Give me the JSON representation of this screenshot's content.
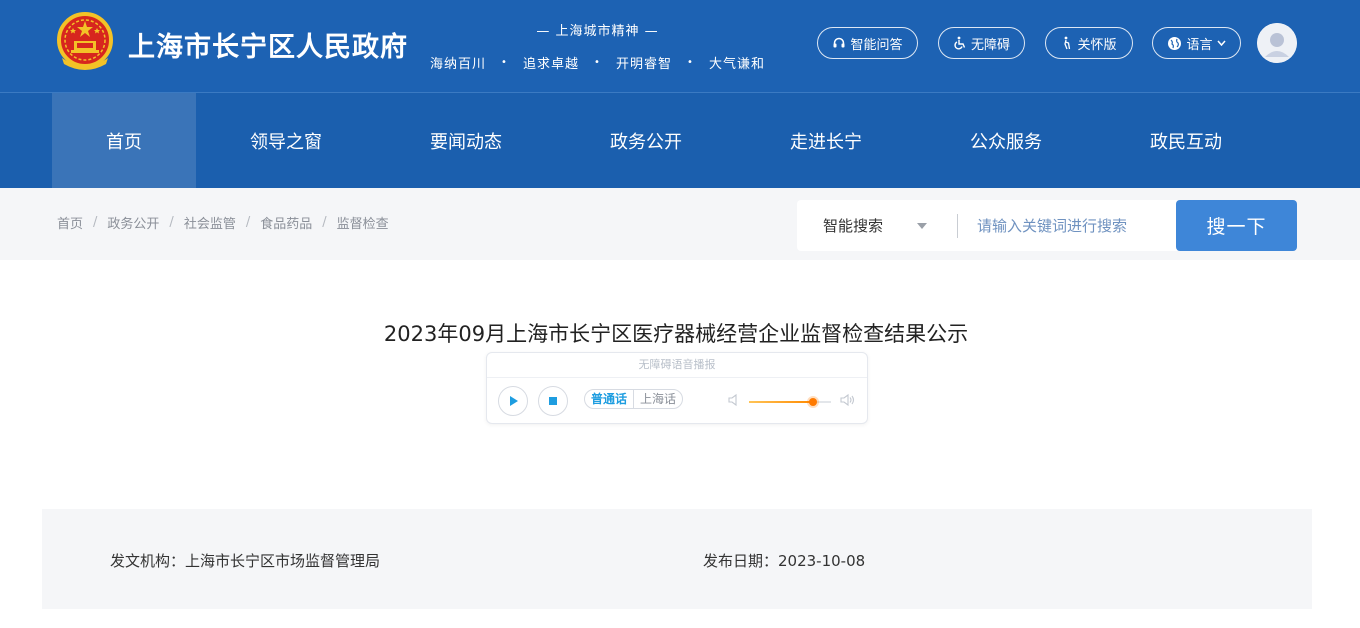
{
  "header": {
    "site_title": "上海市长宁区人民政府",
    "emblem_icon": "national-emblem-icon",
    "spirit": {
      "title": "— 上海城市精神 —",
      "items": [
        "海纳百川",
        "追求卓越",
        "开明睿智",
        "大气谦和"
      ],
      "separator": "•"
    },
    "tools": [
      {
        "label": "智能问答",
        "icon": "headset-icon"
      },
      {
        "label": "无障碍",
        "icon": "wheelchair-icon"
      },
      {
        "label": "关怀版",
        "icon": "elder-icon"
      },
      {
        "label": "语言",
        "icon": "globe-icon"
      }
    ],
    "avatar_icon": "user-avatar-icon"
  },
  "nav": {
    "items": [
      "首页",
      "领导之窗",
      "要闻动态",
      "政务公开",
      "走进长宁",
      "公众服务",
      "政民互动"
    ],
    "active_index": 0
  },
  "breadcrumb": {
    "items": [
      "首页",
      "政务公开",
      "社会监管",
      "食品药品",
      "监督检查"
    ],
    "separator": "/"
  },
  "search": {
    "scope_label": "智能搜索",
    "placeholder": "请输入关键词进行搜索",
    "button_label": "搜一下"
  },
  "article": {
    "title": "2023年09月上海市长宁区医疗器械经营企业监督检查结果公示",
    "player": {
      "label": "无障碍语音播报",
      "dialects": [
        "普通话",
        "上海话"
      ],
      "selected_dialect": "普通话",
      "volume_fraction": 0.78
    },
    "meta": {
      "issuer": "发文机构：上海市长宁区市场监督管理局",
      "date": "发布日期：2023-10-08"
    }
  },
  "colors": {
    "header_bg": "#1d62b3",
    "nav_active_bg": "#3a74b8",
    "search_button": "#3e86d8",
    "strip_bg": "#f5f6f8"
  }
}
